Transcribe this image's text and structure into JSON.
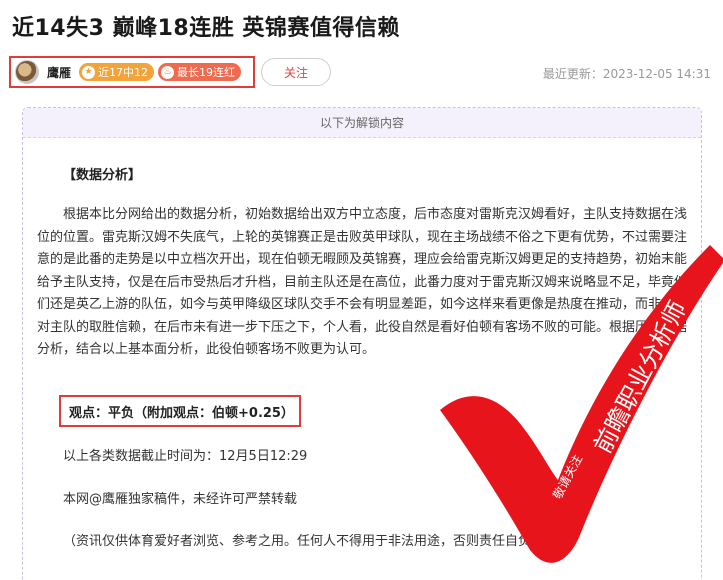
{
  "header": {
    "title": "近14失3 巅峰18连胜 英锦赛值得信赖"
  },
  "author": {
    "name": "鹰雁",
    "badges": [
      {
        "label": "近17中12",
        "icon": "star-icon"
      },
      {
        "label": "最长19连红",
        "icon": "fire-icon"
      }
    ],
    "follow_label": "关注"
  },
  "update": {
    "label": "最近更新：2023-12-05 14:31"
  },
  "article": {
    "unlock_label": "以下为解锁内容",
    "section_title": "【数据分析】",
    "paragraph": "根据本比分网给出的数据分析，初始数据给出双方中立态度，后市态度对雷斯克汉姆看好，主队支持数据在浅位的位置。雷克斯汉姆不失底气，上轮的英锦赛正是击败英甲球队，现在主场战绩不俗之下更有优势，不过需要注意的是此番的走势是以中立档次开出，现在伯顿无暇顾及英锦赛，理应会给雷克斯汉姆更足的支持趋势，初始末能给予主队支持，仅是在后市受热后才升档，目前主队还是在高位，此番力度对于雷克斯汉姆来说略显不足，毕竟他们还是英乙上游的队伍，如今与英甲降级区球队交手不会有明显差距，如今这样来看更像是热度在推动，而非外界对主队的取胜信赖，在后市未有进一步下压之下，个人看，此役自然是看好伯顿有客场不败的可能。根据历史数据分析，结合以上基本面分析，此役伯顿客场不败更为认可。",
    "viewpoint": "观点：平负（附加观点：伯顿+0.25）",
    "cutoff": "以上各类数据截止时间为：12月5日12:29",
    "copyright": "本网@鹰雁独家稿件，未经许可严禁转载",
    "disclaimer": "（资讯仅供体育爱好者浏览、参考之用。任何人不得用于非法用途，否则责任自负。）"
  },
  "stamp": {
    "text_main": "前瞻职业分析师",
    "text_small": "敬请关注",
    "color": "#e8141b"
  }
}
